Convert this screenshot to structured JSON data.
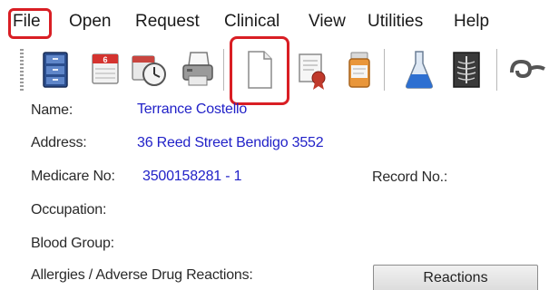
{
  "menubar": {
    "items": [
      "File",
      "Open",
      "Request",
      "Clinical",
      "View",
      "Utilities",
      "Help"
    ]
  },
  "toolbar": {
    "icons": [
      "patient-file-icon",
      "calendar-icon",
      "appointment-clock-icon",
      "printer-icon",
      "new-document-icon",
      "certificate-icon",
      "prescription-bottle-icon",
      "lab-flask-icon",
      "xray-icon",
      "stethoscope-icon"
    ],
    "calendar_day": "6"
  },
  "patient": {
    "name_label": "Name:",
    "name_value": "Terrance Costello",
    "address_label": "Address:",
    "address_value": "36 Reed Street  Bendigo  3552",
    "medicare_label": "Medicare No:",
    "medicare_value": "3500158281 - 1",
    "record_label": "Record No.:",
    "occupation_label": "Occupation:",
    "blood_group_label": "Blood Group:",
    "allergies_label": "Allergies / Adverse Drug Reactions:",
    "reactions_button": "Reactions"
  },
  "colors": {
    "highlight": "#d91e24",
    "value_text": "#2222c8"
  }
}
